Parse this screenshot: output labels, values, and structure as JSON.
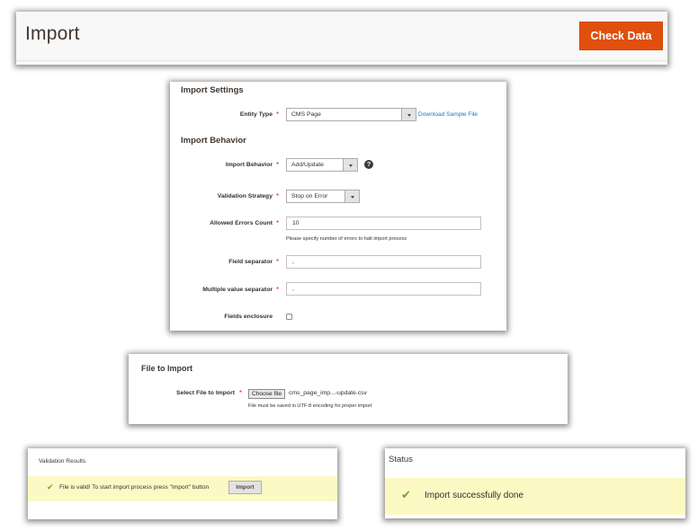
{
  "header": {
    "title": "Import",
    "check_data_label": "Check Data"
  },
  "import_settings": {
    "section_title": "Import Settings",
    "entity_type": {
      "label": "Entity Type",
      "required": true,
      "value": "CMS Page",
      "download_link": "Download Sample File"
    }
  },
  "import_behavior": {
    "section_title": "Import Behavior",
    "behavior": {
      "label": "Import Behavior",
      "required": true,
      "value": "Add/Update",
      "help_icon": "question-circle-icon"
    },
    "validation_strategy": {
      "label": "Validation Strategy",
      "required": true,
      "value": "Stop on Error"
    },
    "allowed_errors": {
      "label": "Allowed Errors Count",
      "required": true,
      "value": "10",
      "note": "Please specify number of errors to halt import process"
    },
    "field_separator": {
      "label": "Field separator",
      "required": true,
      "value": ","
    },
    "multiple_value_separator": {
      "label": "Multiple value separator",
      "required": true,
      "value": ","
    },
    "fields_enclosure": {
      "label": "Fields enclosure",
      "checked": false
    }
  },
  "file_to_import": {
    "section_title": "File to Import",
    "select_file": {
      "label": "Select File to Import",
      "required": true,
      "button_label": "Choose file",
      "file_name": "cms_page_imp...-update.csv",
      "note": "File must be saved in UTF-8 encoding for proper import"
    }
  },
  "validation_results": {
    "heading": "Validation Results",
    "message": "File is valid! To start import process press \"Import\" button",
    "import_button_label": "Import"
  },
  "status": {
    "heading": "Status",
    "message": "Import successfully done"
  },
  "colors": {
    "primary_button": "#e04f0e",
    "link": "#1979c3",
    "required_star": "#e22626",
    "success_check": "#79a22e",
    "message_background": "#fdf9c4"
  }
}
